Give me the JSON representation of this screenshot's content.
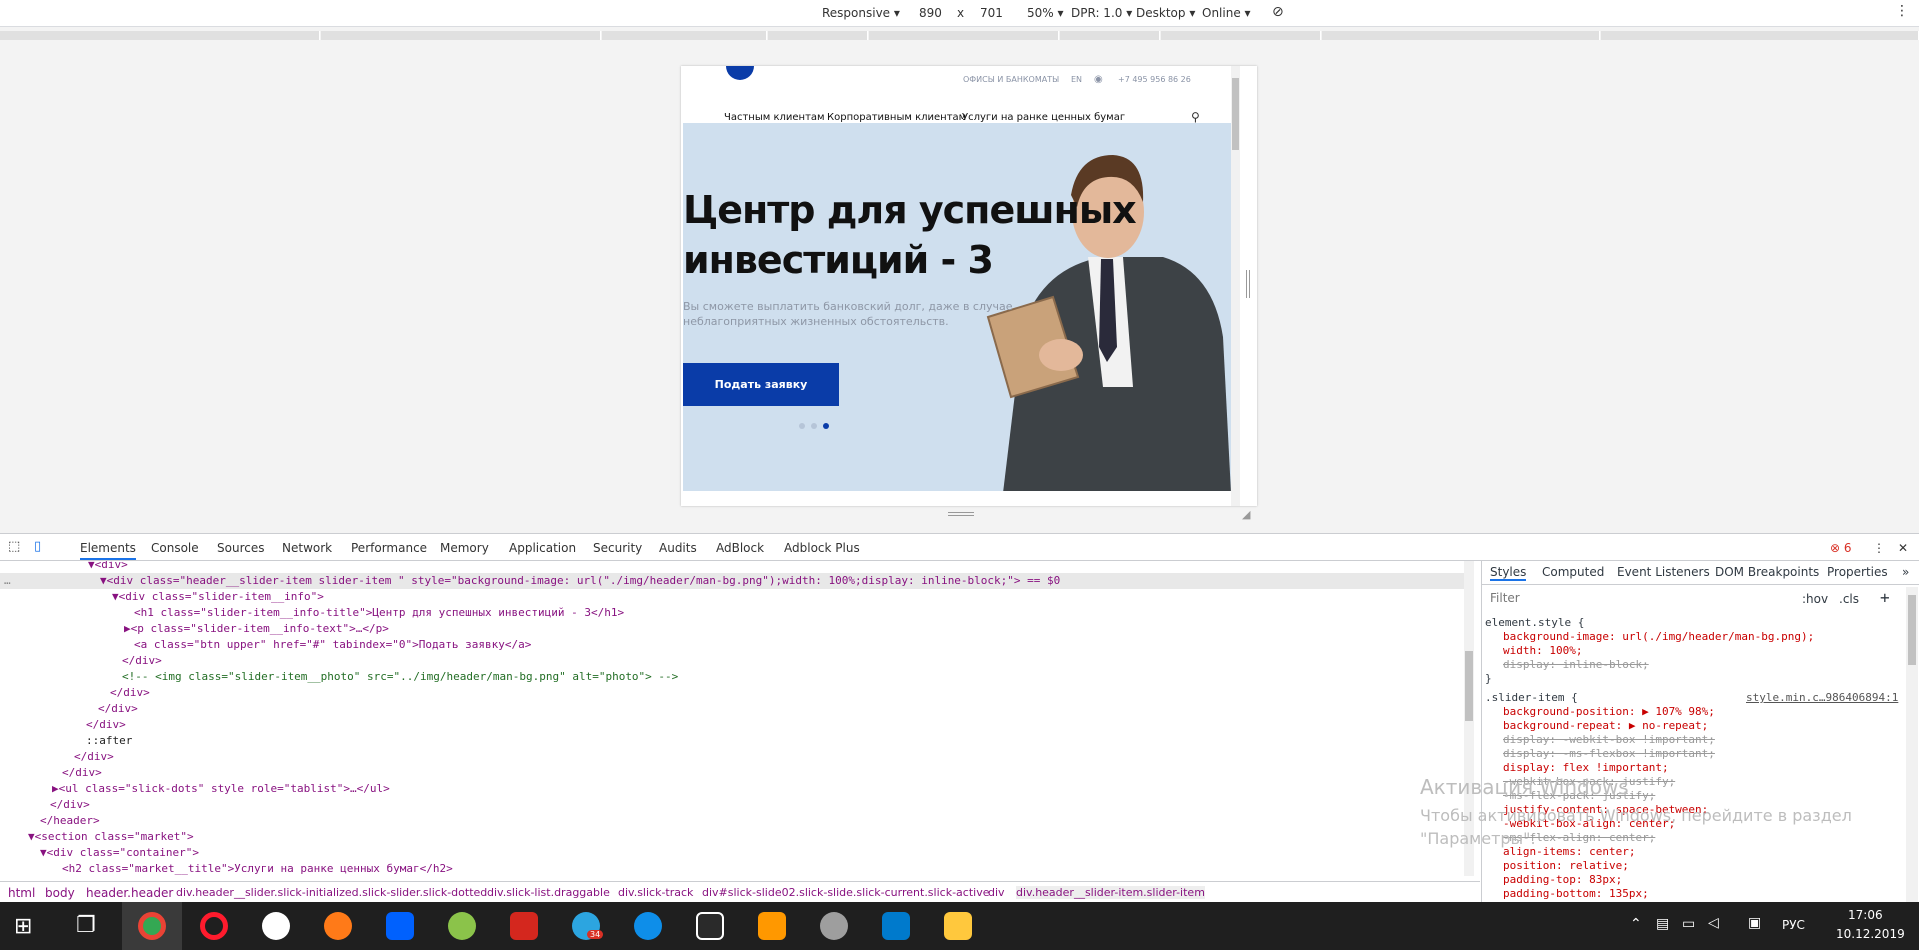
{
  "devtoolbar": {
    "mode": "Responsive",
    "width": "890",
    "times": "x",
    "height": "701",
    "zoom": "50%",
    "dpr": "DPR: 1.0",
    "device_type": "Desktop",
    "network": "Online"
  },
  "site": {
    "top_links": [
      "ОФИСЫ И БАНКОМАТЫ",
      "EN"
    ],
    "phone": "+7 495 956 86 26",
    "nav": [
      "Частным клиентам",
      "Корпоративным клиентам",
      "Услуги на ранке ценных бумаг"
    ],
    "hero_title": "Центр для успешных инвестиций - 3",
    "hero_text": "Вы сможете выплатить банковский долг, даже в случае неблагоприятных жизненных обстоятельств.",
    "hero_button": "Подать заявку"
  },
  "devtools": {
    "tabs": [
      "Elements",
      "Console",
      "Sources",
      "Network",
      "Performance",
      "Memory",
      "Application",
      "Security",
      "Audits",
      "AdBlock",
      "Adblock Plus"
    ],
    "error_count": "6",
    "dom_lines": [
      "▼<div>",
      "▼<div class=\"header__slider-item slider-item \" style=\"background-image: url(\"./img/header/man-bg.png\");width: 100%;display: inline-block;\"> == $0",
      "▼<div class=\"slider-item__info\">",
      "<h1 class=\"slider-item__info-title\">Центр для успешных инвестиций - 3</h1>",
      "▶<p class=\"slider-item__info-text\">…</p>",
      "<a class=\"btn upper\" href=\"#\" tabindex=\"0\">Подать заявку</a>",
      "</div>",
      "<!-- <img class=\"slider-item__photo\" src=\"../img/header/man-bg.png\" alt=\"photo\"> -->",
      "</div>",
      "</div>",
      "</div>",
      "::after",
      "</div>",
      "</div>",
      "▶<ul class=\"slick-dots\" style role=\"tablist\">…</ul>",
      "</div>",
      "</header>",
      "▼<section class=\"market\">",
      "▼<div class=\"container\">",
      "<h2 class=\"market__title\">Услуги на ранке ценных бумаг</h2>"
    ],
    "breadcrumb": [
      "html",
      "body",
      "header.header",
      "div.header__slider.slick-initialized.slick-slider.slick-dotted",
      "div.slick-list.draggable",
      "div.slick-track",
      "div#slick-slide02.slick-slide.slick-current.slick-active",
      "div",
      "div.header__slider-item.slider-item"
    ],
    "styles_tabs": [
      "Styles",
      "Computed",
      "Event Listeners",
      "DOM Breakpoints",
      "Properties"
    ],
    "filter_placeholder": "Filter",
    "hov": ":hov",
    "cls": ".cls",
    "element_style": [
      "element.style {",
      "background-image: url(./img/header/man-bg.png);",
      "width: 100%;",
      "display: inline-block;",
      "}"
    ],
    "rule_selector": ".slider-item {",
    "rule_source": "style.min.c…986406894:1",
    "rule_props": [
      "background-position: ▶ 107% 98%;",
      "background-repeat: ▶ no-repeat;",
      "display: -webkit-box !important;",
      "display: -ms-flexbox !important;",
      "display: flex !important;",
      "-webkit-box-pack: justify;",
      "-ms-flex-pack: justify;",
      "justify-content: space-between;",
      "-webkit-box-align: center;",
      "-ms-flex-align: center;",
      "align-items: center;",
      "position: relative;",
      "padding-top: 83px;",
      "padding-bottom: 135px;"
    ]
  },
  "watermark": {
    "line1": "Активация Windows",
    "line2": "Чтобы активировать Windows, перейдите в раздел",
    "line3": "\"Параметры\"."
  },
  "taskbar": {
    "lang": "РУС",
    "time": "17:06",
    "date": "10.12.2019",
    "badge": "34"
  }
}
